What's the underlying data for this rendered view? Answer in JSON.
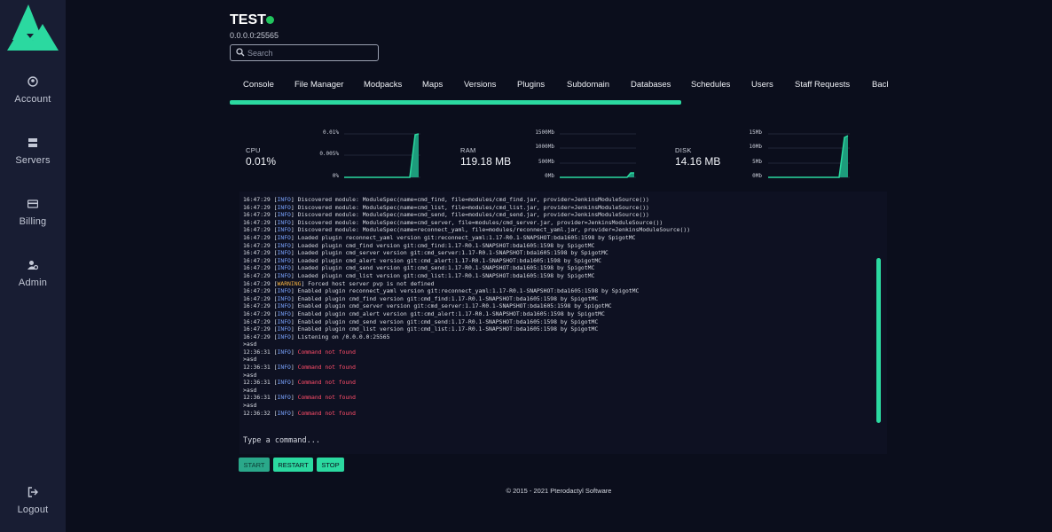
{
  "sidebar": {
    "items": [
      {
        "label": "Account",
        "icon": "user-icon"
      },
      {
        "label": "Servers",
        "icon": "server-icon"
      },
      {
        "label": "Billing",
        "icon": "card-icon"
      },
      {
        "label": "Admin",
        "icon": "user-gear-icon"
      },
      {
        "label": "Logout",
        "icon": "logout-icon"
      }
    ]
  },
  "server": {
    "name": "TEST",
    "address": "0.0.0.0:25565",
    "status_color": "#22c55e"
  },
  "search": {
    "placeholder": "Search"
  },
  "tabs": [
    "Console",
    "File Manager",
    "Modpacks",
    "Maps",
    "Versions",
    "Plugins",
    "Subdomain",
    "Databases",
    "Schedules",
    "Users",
    "Staff Requests",
    "Back"
  ],
  "stats": {
    "cpu": {
      "label": "CPU",
      "value": "0.01%",
      "ticks": [
        "0.01%",
        "0.005%",
        "0%"
      ]
    },
    "ram": {
      "label": "RAM",
      "value": "119.18 MB",
      "ticks": [
        "1500Mb",
        "1000Mb",
        "500Mb",
        "0Mb"
      ]
    },
    "disk": {
      "label": "DISK",
      "value": "14.16 MB",
      "ticks": [
        "15Mb",
        "10Mb",
        "5Mb",
        "0Mb"
      ]
    }
  },
  "console": {
    "lines": [
      {
        "t": "16:47:29",
        "lvl": "INFO",
        "msg": "Discovered module: ModuleSpec(name=cmd_find, file=modules/cmd_find.jar, provider=JenkinsModuleSource())"
      },
      {
        "t": "16:47:29",
        "lvl": "INFO",
        "msg": "Discovered module: ModuleSpec(name=cmd_list, file=modules/cmd_list.jar, provider=JenkinsModuleSource())"
      },
      {
        "t": "16:47:29",
        "lvl": "INFO",
        "msg": "Discovered module: ModuleSpec(name=cmd_send, file=modules/cmd_send.jar, provider=JenkinsModuleSource())"
      },
      {
        "t": "16:47:29",
        "lvl": "INFO",
        "msg": "Discovered module: ModuleSpec(name=cmd_server, file=modules/cmd_server.jar, provider=JenkinsModuleSource())"
      },
      {
        "t": "16:47:29",
        "lvl": "INFO",
        "msg": "Discovered module: ModuleSpec(name=reconnect_yaml, file=modules/reconnect_yaml.jar, provider=JenkinsModuleSource())"
      },
      {
        "t": "16:47:29",
        "lvl": "INFO",
        "msg": "Loaded plugin reconnect_yaml version git:reconnect_yaml:1.17-R0.1-SNAPSHOT:bda1605:1598 by SpigotMC"
      },
      {
        "t": "16:47:29",
        "lvl": "INFO",
        "msg": "Loaded plugin cmd_find version git:cmd_find:1.17-R0.1-SNAPSHOT:bda1605:1598 by SpigotMC"
      },
      {
        "t": "16:47:29",
        "lvl": "INFO",
        "msg": "Loaded plugin cmd_server version git:cmd_server:1.17-R0.1-SNAPSHOT:bda1605:1598 by SpigotMC"
      },
      {
        "t": "16:47:29",
        "lvl": "INFO",
        "msg": "Loaded plugin cmd_alert version git:cmd_alert:1.17-R0.1-SNAPSHOT:bda1605:1598 by SpigotMC"
      },
      {
        "t": "16:47:29",
        "lvl": "INFO",
        "msg": "Loaded plugin cmd_send version git:cmd_send:1.17-R0.1-SNAPSHOT:bda1605:1598 by SpigotMC"
      },
      {
        "t": "16:47:29",
        "lvl": "INFO",
        "msg": "Loaded plugin cmd_list version git:cmd_list:1.17-R0.1-SNAPSHOT:bda1605:1598 by SpigotMC"
      },
      {
        "t": "16:47:29",
        "lvl": "WARNING",
        "msg": "Forced host server pvp is not defined"
      },
      {
        "t": "16:47:29",
        "lvl": "INFO",
        "msg": "Enabled plugin reconnect_yaml version git:reconnect_yaml:1.17-R0.1-SNAPSHOT:bda1605:1598 by SpigotMC"
      },
      {
        "t": "16:47:29",
        "lvl": "INFO",
        "msg": "Enabled plugin cmd_find version git:cmd_find:1.17-R0.1-SNAPSHOT:bda1605:1598 by SpigotMC"
      },
      {
        "t": "16:47:29",
        "lvl": "INFO",
        "msg": "Enabled plugin cmd_server version git:cmd_server:1.17-R0.1-SNAPSHOT:bda1605:1598 by SpigotMC"
      },
      {
        "t": "16:47:29",
        "lvl": "INFO",
        "msg": "Enabled plugin cmd_alert version git:cmd_alert:1.17-R0.1-SNAPSHOT:bda1605:1598 by SpigotMC"
      },
      {
        "t": "16:47:29",
        "lvl": "INFO",
        "msg": "Enabled plugin cmd_send version git:cmd_send:1.17-R0.1-SNAPSHOT:bda1605:1598 by SpigotMC"
      },
      {
        "t": "16:47:29",
        "lvl": "INFO",
        "msg": "Enabled plugin cmd_list version git:cmd_list:1.17-R0.1-SNAPSHOT:bda1605:1598 by SpigotMC"
      },
      {
        "t": "16:47:29",
        "lvl": "INFO",
        "msg": "Listening on /0.0.0.0:25565"
      },
      {
        "raw": ">asd"
      },
      {
        "t": "12:36:31",
        "lvl": "INFO",
        "msg": "Command not found",
        "err": true
      },
      {
        "raw": ">asd"
      },
      {
        "t": "12:36:31",
        "lvl": "INFO",
        "msg": "Command not found",
        "err": true
      },
      {
        "raw": ">asd"
      },
      {
        "t": "12:36:31",
        "lvl": "INFO",
        "msg": "Command not found",
        "err": true
      },
      {
        "raw": ">asd"
      },
      {
        "t": "12:36:31",
        "lvl": "INFO",
        "msg": "Command not found",
        "err": true
      },
      {
        "raw": ">asd"
      },
      {
        "t": "12:36:32",
        "lvl": "INFO",
        "msg": "Command not found",
        "err": true
      }
    ],
    "input_placeholder": "Type a command..."
  },
  "buttons": {
    "start": "START",
    "restart": "RESTART",
    "stop": "STOP"
  },
  "footer": "© 2015 - 2021 Pterodactyl Software",
  "colors": {
    "accent": "#2bd9a0",
    "background": "#0b0e1c",
    "sidebar": "#181d33",
    "error": "#ff4d6a",
    "warning": "#f5b342",
    "info": "#7aa4ff"
  }
}
